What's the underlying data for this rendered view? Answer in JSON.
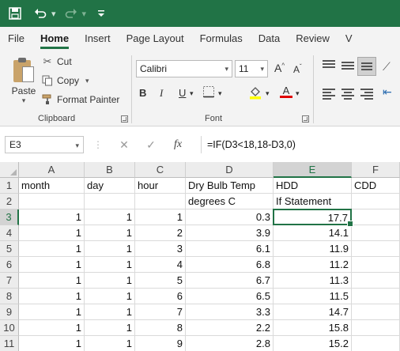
{
  "qat": {
    "save_icon": "save-icon",
    "undo_icon": "undo-icon",
    "redo_icon": "redo-icon",
    "customize_icon": "customize-icon"
  },
  "tabs": [
    {
      "label": "File"
    },
    {
      "label": "Home",
      "active": true
    },
    {
      "label": "Insert"
    },
    {
      "label": "Page Layout"
    },
    {
      "label": "Formulas"
    },
    {
      "label": "Data"
    },
    {
      "label": "Review"
    },
    {
      "label": "V"
    }
  ],
  "clipboard": {
    "paste_label": "Paste",
    "cut_label": "Cut",
    "copy_label": "Copy",
    "format_painter_label": "Format Painter",
    "group_label": "Clipboard"
  },
  "font": {
    "family": "Calibri",
    "size": "11",
    "bold": "B",
    "italic": "I",
    "underline": "U",
    "font_color_glyph": "A",
    "group_label": "Font"
  },
  "formula_bar": {
    "name_box": "E3",
    "cancel_glyph": "✕",
    "enter_glyph": "✓",
    "fx_glyph": "fx",
    "formula": "=IF(D3<18,18-D3,0)"
  },
  "columns": [
    "A",
    "B",
    "C",
    "D",
    "E",
    "F"
  ],
  "rows": [
    {
      "n": "1",
      "cells": [
        "month",
        "day",
        "hour",
        "Dry Bulb Temp",
        "HDD",
        "CDD"
      ]
    },
    {
      "n": "2",
      "cells": [
        "",
        "",
        "",
        "degrees C",
        "If Statement",
        ""
      ]
    },
    {
      "n": "3",
      "cells": [
        "1",
        "1",
        "1",
        "0.3",
        "17.7",
        ""
      ]
    },
    {
      "n": "4",
      "cells": [
        "1",
        "1",
        "2",
        "3.9",
        "14.1",
        ""
      ]
    },
    {
      "n": "5",
      "cells": [
        "1",
        "1",
        "3",
        "6.1",
        "11.9",
        ""
      ]
    },
    {
      "n": "6",
      "cells": [
        "1",
        "1",
        "4",
        "6.8",
        "11.2",
        ""
      ]
    },
    {
      "n": "7",
      "cells": [
        "1",
        "1",
        "5",
        "6.7",
        "11.3",
        ""
      ]
    },
    {
      "n": "8",
      "cells": [
        "1",
        "1",
        "6",
        "6.5",
        "11.5",
        ""
      ]
    },
    {
      "n": "9",
      "cells": [
        "1",
        "1",
        "7",
        "3.3",
        "14.7",
        ""
      ]
    },
    {
      "n": "10",
      "cells": [
        "1",
        "1",
        "8",
        "2.2",
        "15.8",
        ""
      ]
    },
    {
      "n": "11",
      "cells": [
        "1",
        "1",
        "9",
        "2.8",
        "15.2",
        ""
      ]
    }
  ],
  "active_cell": "E3",
  "colors": {
    "accent": "#217346"
  }
}
